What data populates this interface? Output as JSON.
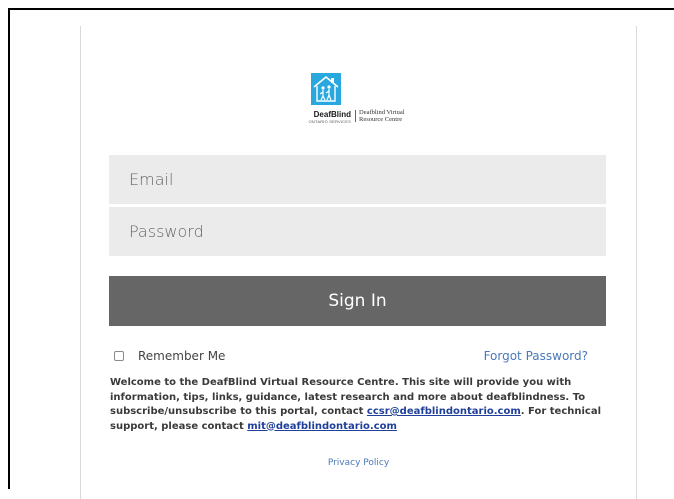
{
  "logo": {
    "brand_name": "DeafBlind",
    "brand_sub": "ONTARIO SERVICES",
    "product_line1": "Deafblind Virtual",
    "product_line2": "Resource Centre",
    "accent_color": "#29a8e0"
  },
  "form": {
    "email_placeholder": "Email",
    "password_placeholder": "Password",
    "signin_label": "Sign In",
    "remember_label": "Remember Me",
    "forgot_label": "Forgot Password?"
  },
  "welcome": {
    "text_part1": "Welcome to the DeafBlind Virtual Resource Centre. This site will provide you with information, tips, links, guidance, latest research and more about deafblindness.  To subscribe/unsubscribe to this portal, contact ",
    "email1": "ccsr@deafblindontario.com",
    "text_part2": ". For technical support, please contact ",
    "email2": "mit@deafblindontario.com"
  },
  "footer": {
    "privacy_label": "Privacy Policy"
  }
}
